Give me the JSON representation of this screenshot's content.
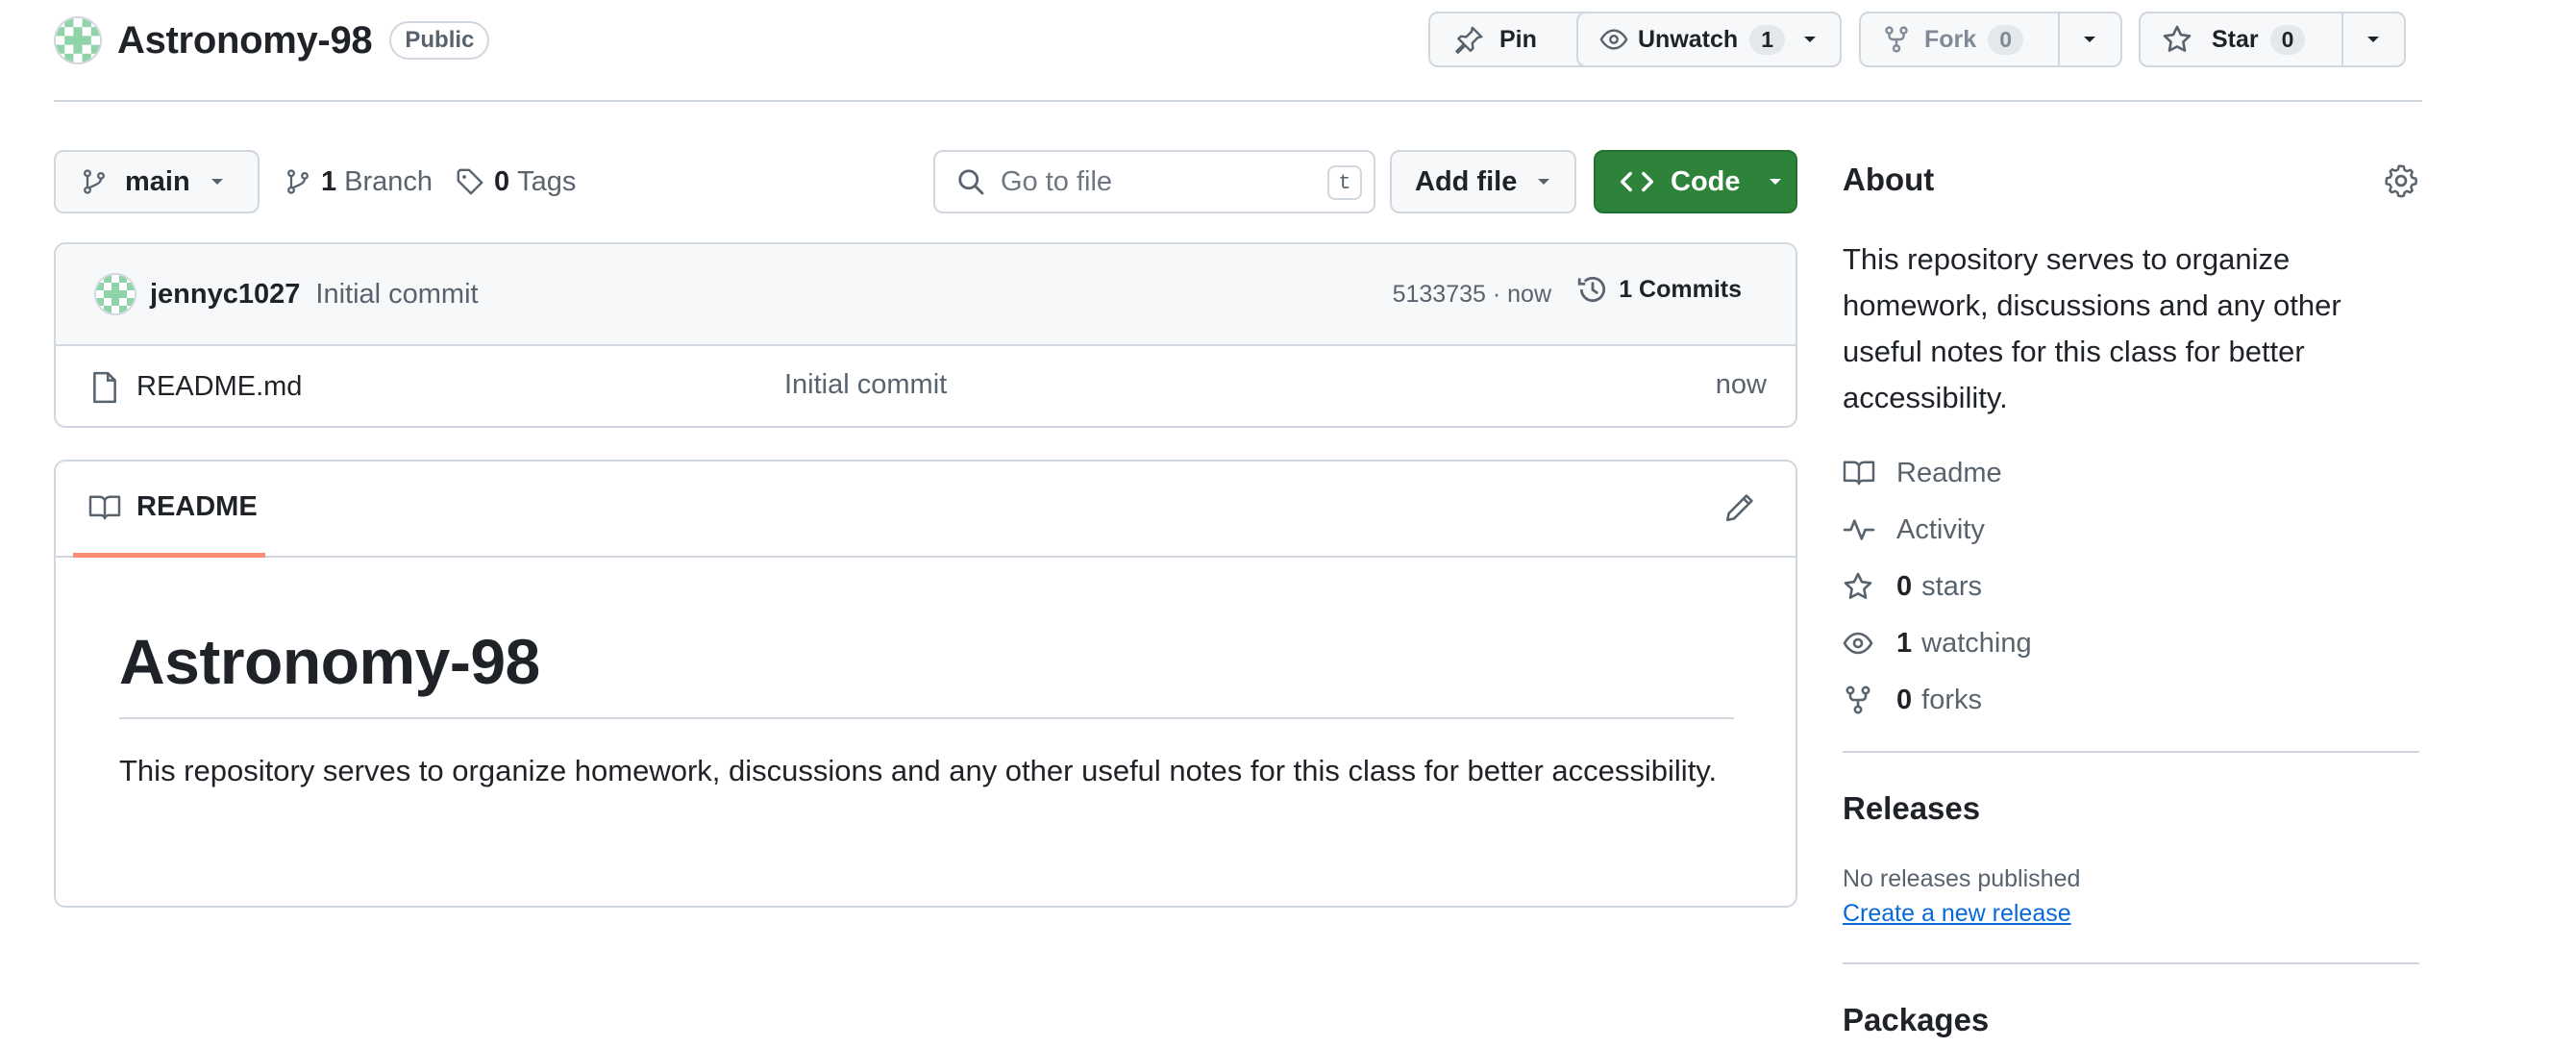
{
  "repo": {
    "name": "Astronomy-98",
    "visibility": "Public"
  },
  "header_actions": {
    "pin_label": "Pin",
    "unwatch_label": "Unwatch",
    "watch_count": "1",
    "fork_label": "Fork",
    "fork_count": "0",
    "star_label": "Star",
    "star_count": "0"
  },
  "toolbar": {
    "branch_name": "main",
    "branch_count": "1",
    "branch_label": "Branch",
    "tag_count": "0",
    "tag_label": "Tags",
    "search_placeholder": "Go to file",
    "search_shortcut": "t",
    "add_file_label": "Add file",
    "code_label": "Code"
  },
  "latest_commit": {
    "author": "jennyc1027",
    "message": "Initial commit",
    "meta": "5133735 · now",
    "commits_label": "1 Commits"
  },
  "files": [
    {
      "name": "README.md",
      "commit_message": "Initial commit",
      "time": "now"
    }
  ],
  "readme": {
    "tab_label": "README",
    "heading": "Astronomy-98",
    "body": "This repository serves to organize homework, discussions and any other useful notes for this class for better accessibility."
  },
  "about": {
    "title": "About",
    "description": "This repository serves to organize homework, discussions and any other useful notes for this class for better accessibility.",
    "readme_label": "Readme",
    "activity_label": "Activity",
    "stars_count": "0",
    "stars_label": "stars",
    "watching_count": "1",
    "watching_label": "watching",
    "forks_count": "0",
    "forks_label": "forks"
  },
  "releases": {
    "title": "Releases",
    "empty_text": "No releases published",
    "create_link": "Create a new release"
  },
  "packages": {
    "title": "Packages"
  },
  "colors": {
    "code_button": "#2c8339",
    "link": "#0969da",
    "tab_underline": "#fd8c73"
  }
}
